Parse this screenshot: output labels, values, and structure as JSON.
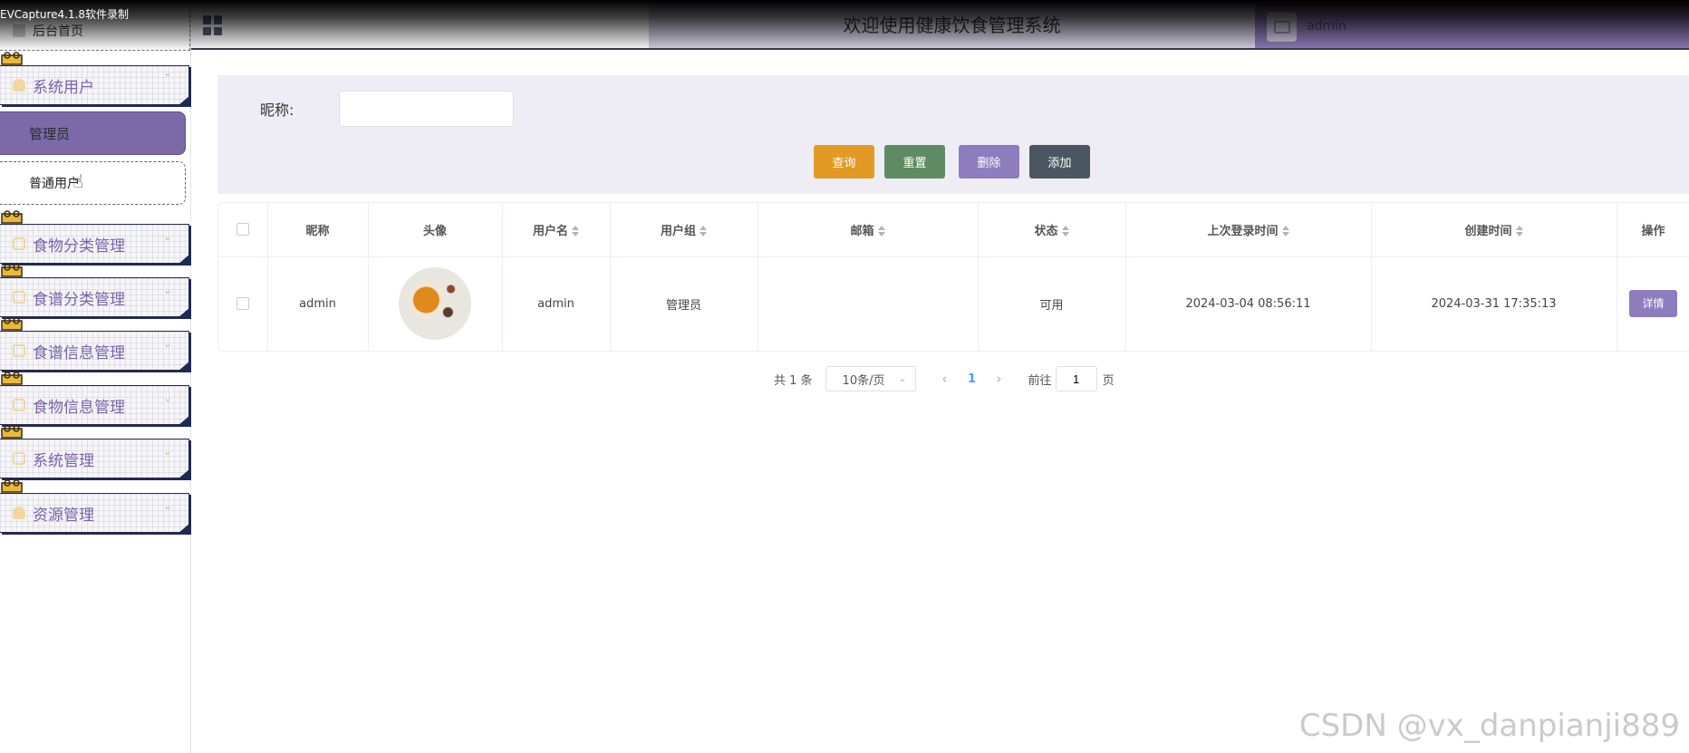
{
  "recorder": {
    "label": "EVCapture4.1.8软件录制"
  },
  "watermark": "CSDN @vx_danpianji889",
  "header": {
    "title": "欢迎使用健康饮食管理系统",
    "user": "admin"
  },
  "sidebar": {
    "home": "后台首页",
    "groups": [
      {
        "label": "系统用户"
      },
      {
        "label": "食物分类管理"
      },
      {
        "label": "食谱分类管理"
      },
      {
        "label": "食谱信息管理"
      },
      {
        "label": "食物信息管理"
      },
      {
        "label": "系统管理"
      },
      {
        "label": "资源管理"
      }
    ],
    "sub_items": [
      {
        "label": "管理员",
        "active": true
      },
      {
        "label": "普通用户",
        "active": false
      }
    ]
  },
  "search": {
    "label": "昵称:",
    "value": "",
    "buttons": {
      "query": "查询",
      "reset": "重置",
      "delete": "删除",
      "add": "添加"
    }
  },
  "table": {
    "columns": [
      "昵称",
      "头像",
      "用户名",
      "用户组",
      "邮箱",
      "状态",
      "上次登录时间",
      "创建时间",
      "操作"
    ],
    "rows": [
      {
        "nickname": "admin",
        "username": "admin",
        "group": "管理员",
        "email": "",
        "status": "可用",
        "last_login": "2024-03-04 08:56:11",
        "created": "2024-03-31 17:35:13",
        "action": "详情"
      }
    ]
  },
  "pagination": {
    "total": "共 1 条",
    "page_size": "10条/页",
    "current_page": "1",
    "goto_label": "前往",
    "goto_value": "1",
    "page_suffix": "页"
  },
  "colors": {
    "accent_purple": "#8d7dbf",
    "query_orange": "#e29a25",
    "reset_green": "#5f8b62",
    "add_slate": "#4a5762"
  }
}
